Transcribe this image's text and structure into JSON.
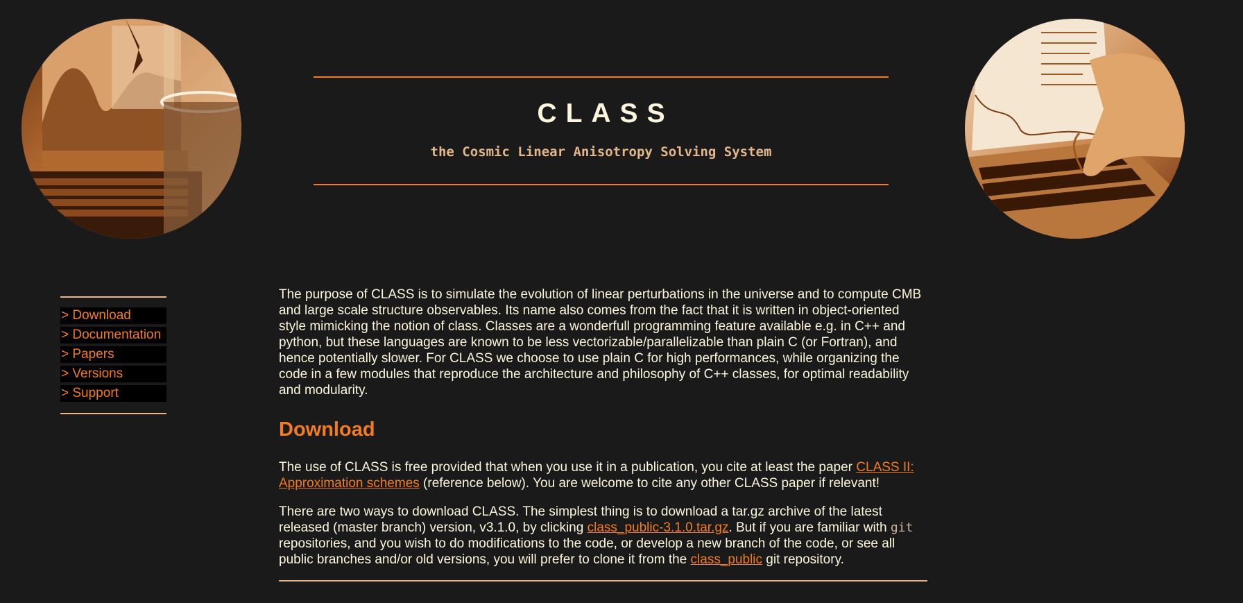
{
  "header": {
    "title": "CLASS",
    "subtitle": "the Cosmic Linear Anisotropy Solving System"
  },
  "images": {
    "left": "laptop-with-glass-photo",
    "right": "hand-typing-on-laptop-photo"
  },
  "nav": {
    "items": [
      {
        "label": "> Download"
      },
      {
        "label": "> Documentation"
      },
      {
        "label": "> Papers"
      },
      {
        "label": "> Versions"
      },
      {
        "label": "> Support"
      }
    ]
  },
  "intro": {
    "text": "The purpose of CLASS is to simulate the evolution of linear perturbations in the universe and to compute CMB and large scale structure observables. Its name also comes from the fact that it is written in object-oriented style mimicking the notion of class. Classes are a wonderfull programming feature available e.g. in C++ and python, but these languages are known to be less vectorizable/parallelizable than plain C (or Fortran), and hence potentially slower. For CLASS we choose to use plain C for high performances, while organizing the code in a few modules that reproduce the architecture and philosophy of C++ classes, for optimal readability and modularity."
  },
  "download": {
    "heading": "Download",
    "p1_before": "The use of CLASS is free provided that when you use it in a publication, you cite at least the paper ",
    "p1_link": "CLASS II: Approximation schemes",
    "p1_after": " (reference below). You are welcome to cite any other CLASS paper if relevant!",
    "p2_part1": "There are two ways to download CLASS. The simplest thing is to download a tar.gz archive of the latest released (master branch) version, v3.1.0, by clicking ",
    "p2_link1": "class_public-3.1.0.tar.gz",
    "p2_part2": ". But if you are familiar with ",
    "p2_code": "git",
    "p2_part3": " repositories, and you wish to do modifications to the code, or develop a new branch of the code, or see all public branches and/or old versions, you will prefer to clone it from the ",
    "p2_link2": "class_public",
    "p2_part4": " git repository."
  },
  "colors": {
    "background": "#1a1a1a",
    "accent": "#f47c20",
    "text": "#fdf6dc",
    "subtitle": "#e3b789"
  }
}
